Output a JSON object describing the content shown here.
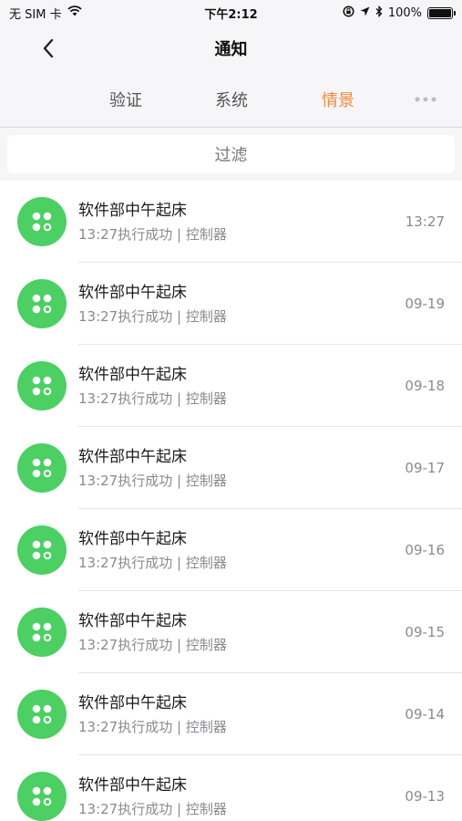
{
  "status": {
    "carrier": "无 SIM 卡",
    "time": "下午2:12",
    "battery": "100%",
    "battery_level": 1.0
  },
  "nav": {
    "title": "通知"
  },
  "tabs": [
    {
      "label": "验证",
      "active": false
    },
    {
      "label": "系统",
      "active": false
    },
    {
      "label": "情景",
      "active": true
    }
  ],
  "filter": {
    "label": "过滤"
  },
  "colors": {
    "accent": "#f08a3b",
    "avatar": "#4ccf63"
  },
  "notifications": [
    {
      "title": "软件部中午起床",
      "subtitle": "13:27执行成功 | 控制器",
      "date": "13:27"
    },
    {
      "title": "软件部中午起床",
      "subtitle": "13:27执行成功 | 控制器",
      "date": "09-19"
    },
    {
      "title": "软件部中午起床",
      "subtitle": "13:27执行成功 | 控制器",
      "date": "09-18"
    },
    {
      "title": "软件部中午起床",
      "subtitle": "13:27执行成功 | 控制器",
      "date": "09-17"
    },
    {
      "title": "软件部中午起床",
      "subtitle": "13:27执行成功 | 控制器",
      "date": "09-16"
    },
    {
      "title": "软件部中午起床",
      "subtitle": "13:27执行成功 | 控制器",
      "date": "09-15"
    },
    {
      "title": "软件部中午起床",
      "subtitle": "13:27执行成功 | 控制器",
      "date": "09-14"
    },
    {
      "title": "软件部中午起床",
      "subtitle": "13:27执行成功 | 控制器",
      "date": "09-13"
    }
  ]
}
